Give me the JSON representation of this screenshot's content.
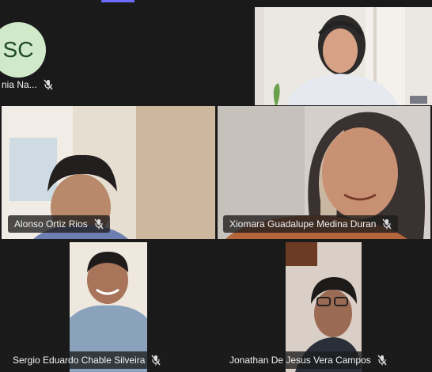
{
  "participants": [
    {
      "initials": "SC",
      "name": "nia Na..."
    },
    {
      "name": ""
    },
    {
      "name": "Alonso Ortiz Rios"
    },
    {
      "name": "Xiomara Guadalupe Medina Duran"
    },
    {
      "name": "Sergio Eduardo Chable Silveira"
    },
    {
      "name": "Jonathan De Jesus Vera Campos"
    }
  ],
  "icons": {
    "muted": "mic-off-icon"
  },
  "colors": {
    "background": "#1a1a1a",
    "avatar_bg": "#cfe9c9",
    "active_speaker": "#6b6bff"
  }
}
